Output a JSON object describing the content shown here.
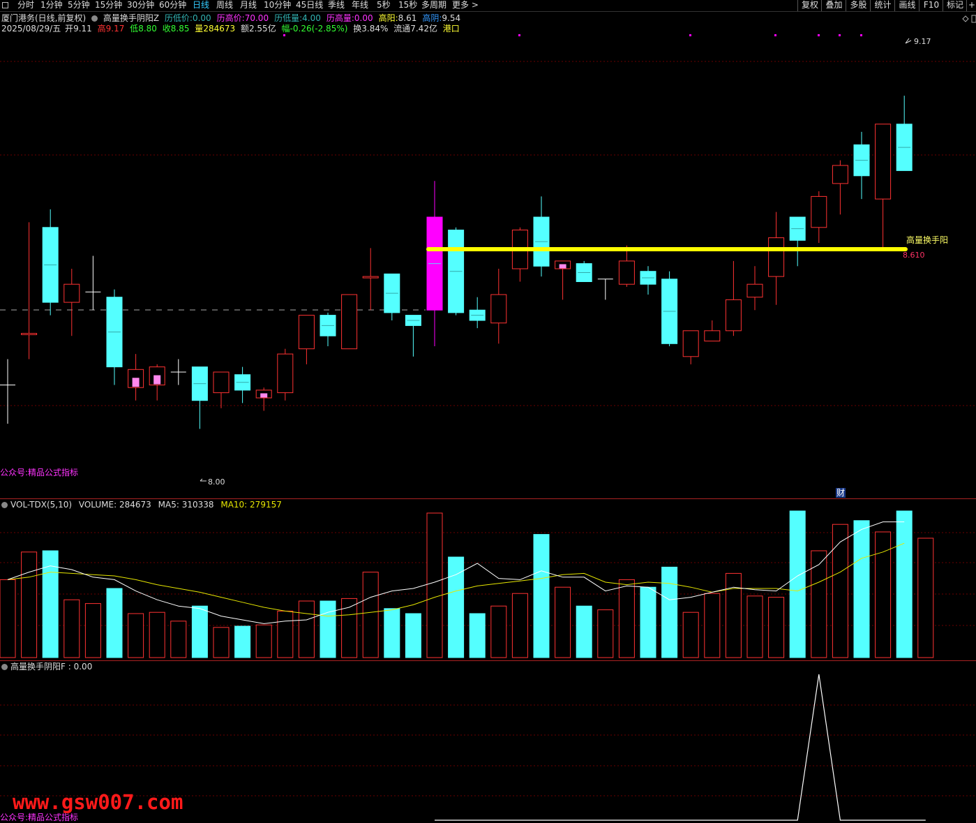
{
  "toolbar": {
    "items": [
      "分时",
      "1分钟",
      "5分钟",
      "15分钟",
      "30分钟",
      "60分钟",
      "日线",
      "周线",
      "月线",
      "10分钟",
      "45日线",
      "季线",
      "年线",
      "5秒",
      "15秒",
      "多周期",
      "更多 >"
    ],
    "active": "日线",
    "right_items": [
      "复权",
      "叠加",
      "多股",
      "统计",
      "画线",
      "F10",
      "标记",
      "+"
    ]
  },
  "header": {
    "stock": "厦门港务(日线,前复权)",
    "indicator": "高量换手阴阳Z",
    "fields": [
      {
        "label": "历低价:",
        "value": "0.00",
        "color": "#32b3b3"
      },
      {
        "label": "历高价:",
        "value": "70.00",
        "color": "#ff33ff"
      },
      {
        "label": "历低量:",
        "value": "4.00",
        "color": "#32b3b3"
      },
      {
        "label": "历高量:",
        "value": "0.00",
        "color": "#ff33ff"
      },
      {
        "label": "高阳:",
        "value": "8.61",
        "color": "#ffff33"
      },
      {
        "label": "高阴:",
        "value": "9.54",
        "color": "#3399ff"
      }
    ]
  },
  "quote": {
    "date": "2025/08/29/五",
    "open_label": "开",
    "open": "9.11",
    "high_label": "高",
    "high": "9.17",
    "low_label": "低",
    "low": "8.80",
    "close_label": "收",
    "close": "8.85",
    "vol_label": "量",
    "vol": "284673",
    "amount_label": "额",
    "amount": "2.55亿",
    "change_label": "幅",
    "change": "-0.26(-2.85%)",
    "turnover_label": "换",
    "turnover": "3.84%",
    "float_label": "流通",
    "float": "7.42亿",
    "tag": "港口"
  },
  "main_pane": {
    "watermark_top": "公众号:精品公式指标",
    "high_label": "9.17",
    "low_label": "8.00",
    "line_label": "高量换手阳",
    "line_value": "8.610",
    "fin_marker": "财"
  },
  "volume_pane": {
    "title": "VOL-TDX(5,10)",
    "volume_label": "VOLUME:",
    "volume": "284673",
    "ma5_label": "MA5:",
    "ma5": "310338",
    "ma10_label": "MA10:",
    "ma10": "279157"
  },
  "indicator_pane": {
    "title": "高量换手阴阳F",
    "value_label": ":",
    "value": "0.00",
    "watermark_bottom": "公众号:精品公式指标"
  },
  "site_watermark": "www.gsw007.com",
  "colors": {
    "up": "#ff3232",
    "down": "#54ffff",
    "special": "#ff00ff",
    "highlight": "#ffff00",
    "ma5": "#ffffff",
    "ma10": "#e6e600",
    "grid": "#8b0000"
  },
  "chart_data": {
    "type": "candlestick",
    "price_range": [
      7.7,
      9.4
    ],
    "candles": [
      {
        "o": 8.05,
        "h": 8.15,
        "l": 7.9,
        "c": 8.05,
        "dir": "doji"
      },
      {
        "o": 8.25,
        "h": 8.68,
        "l": 8.15,
        "c": 8.25,
        "dir": "up",
        "b": 8.46
      },
      {
        "o": 8.66,
        "h": 8.73,
        "l": 8.32,
        "c": 8.37,
        "dir": "down"
      },
      {
        "o": 8.37,
        "h": 8.5,
        "l": 8.24,
        "c": 8.44,
        "dir": "up"
      },
      {
        "o": 8.41,
        "h": 8.55,
        "l": 8.34,
        "c": 8.41,
        "dir": "doji"
      },
      {
        "o": 8.39,
        "h": 8.42,
        "l": 8.05,
        "c": 8.12,
        "dir": "down"
      },
      {
        "o": 8.04,
        "h": 8.17,
        "l": 7.99,
        "c": 8.11,
        "dir": "up",
        "pink": true
      },
      {
        "o": 8.05,
        "h": 8.13,
        "l": 7.99,
        "c": 8.12,
        "dir": "up",
        "pink": true
      },
      {
        "o": 8.1,
        "h": 8.15,
        "l": 8.05,
        "c": 8.1,
        "dir": "doji"
      },
      {
        "o": 8.12,
        "h": 8.12,
        "l": 7.88,
        "c": 7.99,
        "dir": "down"
      },
      {
        "o": 8.02,
        "h": 8.1,
        "l": 7.96,
        "c": 8.1,
        "dir": "up"
      },
      {
        "o": 8.09,
        "h": 8.12,
        "l": 7.98,
        "c": 8.03,
        "dir": "down"
      },
      {
        "o": 8.0,
        "h": 8.04,
        "l": 7.95,
        "c": 8.03,
        "dir": "up",
        "pink": true
      },
      {
        "o": 8.02,
        "h": 8.19,
        "l": 7.99,
        "c": 8.17,
        "dir": "up"
      },
      {
        "o": 8.19,
        "h": 8.32,
        "l": 8.13,
        "c": 8.32,
        "dir": "up"
      },
      {
        "o": 8.32,
        "h": 8.33,
        "l": 8.2,
        "c": 8.24,
        "dir": "down"
      },
      {
        "o": 8.19,
        "h": 8.4,
        "l": 8.19,
        "c": 8.4,
        "dir": "up"
      },
      {
        "o": 8.47,
        "h": 8.58,
        "l": 8.34,
        "c": 8.47,
        "dir": "up",
        "b": 8.43
      },
      {
        "o": 8.48,
        "h": 8.48,
        "l": 8.3,
        "c": 8.33,
        "dir": "down"
      },
      {
        "o": 8.32,
        "h": 8.32,
        "l": 8.16,
        "c": 8.28,
        "dir": "down"
      },
      {
        "o": 8.34,
        "h": 8.84,
        "l": 8.2,
        "c": 8.7,
        "dir": "special"
      },
      {
        "o": 8.65,
        "h": 8.66,
        "l": 8.32,
        "c": 8.33,
        "dir": "down"
      },
      {
        "o": 8.34,
        "h": 8.39,
        "l": 8.27,
        "c": 8.3,
        "dir": "down"
      },
      {
        "o": 8.29,
        "h": 8.5,
        "l": 8.21,
        "c": 8.4,
        "dir": "up"
      },
      {
        "o": 8.5,
        "h": 8.66,
        "l": 8.45,
        "c": 8.65,
        "dir": "up"
      },
      {
        "o": 8.7,
        "h": 8.78,
        "l": 8.47,
        "c": 8.51,
        "dir": "down"
      },
      {
        "o": 8.5,
        "h": 8.52,
        "l": 8.38,
        "c": 8.53,
        "dir": "up",
        "pink": true
      },
      {
        "o": 8.52,
        "h": 8.53,
        "l": 8.45,
        "c": 8.45,
        "dir": "down"
      },
      {
        "o": 8.46,
        "h": 8.46,
        "l": 8.38,
        "c": 8.46,
        "dir": "doji"
      },
      {
        "o": 8.44,
        "h": 8.59,
        "l": 8.43,
        "c": 8.53,
        "dir": "up"
      },
      {
        "o": 8.49,
        "h": 8.51,
        "l": 8.4,
        "c": 8.44,
        "dir": "down"
      },
      {
        "o": 8.46,
        "h": 8.49,
        "l": 8.2,
        "c": 8.21,
        "dir": "down"
      },
      {
        "o": 8.16,
        "h": 8.26,
        "l": 8.13,
        "c": 8.26,
        "dir": "up"
      },
      {
        "o": 8.22,
        "h": 8.3,
        "l": 8.22,
        "c": 8.26,
        "dir": "up"
      },
      {
        "o": 8.26,
        "h": 8.53,
        "l": 8.24,
        "c": 8.38,
        "dir": "up"
      },
      {
        "o": 8.39,
        "h": 8.51,
        "l": 8.34,
        "c": 8.44,
        "dir": "up"
      },
      {
        "o": 8.47,
        "h": 8.72,
        "l": 8.36,
        "c": 8.62,
        "dir": "up"
      },
      {
        "o": 8.7,
        "h": 8.67,
        "l": 8.51,
        "c": 8.61,
        "dir": "down"
      },
      {
        "o": 8.66,
        "h": 8.8,
        "l": 8.6,
        "c": 8.78,
        "dir": "up"
      },
      {
        "o": 8.9,
        "h": 8.92,
        "l": 8.71,
        "c": 8.83,
        "dir": "up"
      },
      {
        "o": 8.86,
        "h": 9.03,
        "l": 8.77,
        "c": 8.98,
        "dir": "down"
      },
      {
        "o": 8.77,
        "h": 9.06,
        "l": 8.57,
        "c": 9.06,
        "dir": "up"
      },
      {
        "o": 9.06,
        "h": 9.17,
        "l": 8.91,
        "c": 8.88,
        "dir": "down"
      }
    ],
    "volume": [
      0.62,
      0.84,
      0.85,
      0.46,
      0.43,
      0.55,
      0.35,
      0.36,
      0.29,
      0.41,
      0.24,
      0.25,
      0.26,
      0.37,
      0.45,
      0.45,
      0.47,
      0.68,
      0.39,
      0.35,
      1.15,
      0.8,
      0.35,
      0.41,
      0.51,
      0.98,
      0.56,
      0.41,
      0.38,
      0.62,
      0.56,
      0.72,
      0.36,
      0.51,
      0.67,
      0.49,
      0.48,
      1.34,
      0.85,
      1.06,
      1.09,
      1.0,
      1.23,
      0.95
    ],
    "ma5": [
      0.62,
      0.68,
      0.73,
      0.7,
      0.64,
      0.62,
      0.53,
      0.46,
      0.41,
      0.39,
      0.33,
      0.3,
      0.27,
      0.29,
      0.3,
      0.36,
      0.4,
      0.48,
      0.53,
      0.55,
      0.6,
      0.66,
      0.75,
      0.63,
      0.62,
      0.69,
      0.64,
      0.64,
      0.53,
      0.57,
      0.56,
      0.46,
      0.48,
      0.52,
      0.56,
      0.54,
      0.53,
      0.65,
      0.74,
      0.92,
      1.02,
      1.08,
      1.08
    ],
    "ma10": [
      0.62,
      0.64,
      0.68,
      0.67,
      0.66,
      0.65,
      0.62,
      0.58,
      0.55,
      0.52,
      0.48,
      0.44,
      0.4,
      0.37,
      0.35,
      0.33,
      0.34,
      0.36,
      0.38,
      0.42,
      0.48,
      0.53,
      0.57,
      0.59,
      0.61,
      0.63,
      0.66,
      0.67,
      0.6,
      0.58,
      0.6,
      0.59,
      0.56,
      0.52,
      0.55,
      0.55,
      0.55,
      0.53,
      0.6,
      0.68,
      0.79,
      0.84,
      0.91
    ],
    "indicator": [
      0,
      0,
      0,
      0,
      0,
      0,
      0,
      0,
      0,
      0,
      0,
      0,
      0,
      0,
      0,
      0,
      0,
      0,
      0,
      0,
      0,
      0,
      0,
      0,
      0,
      0,
      0,
      0,
      0,
      0,
      0,
      0,
      0,
      0,
      0,
      0,
      0,
      0,
      1,
      0,
      0,
      0,
      0,
      0
    ]
  }
}
